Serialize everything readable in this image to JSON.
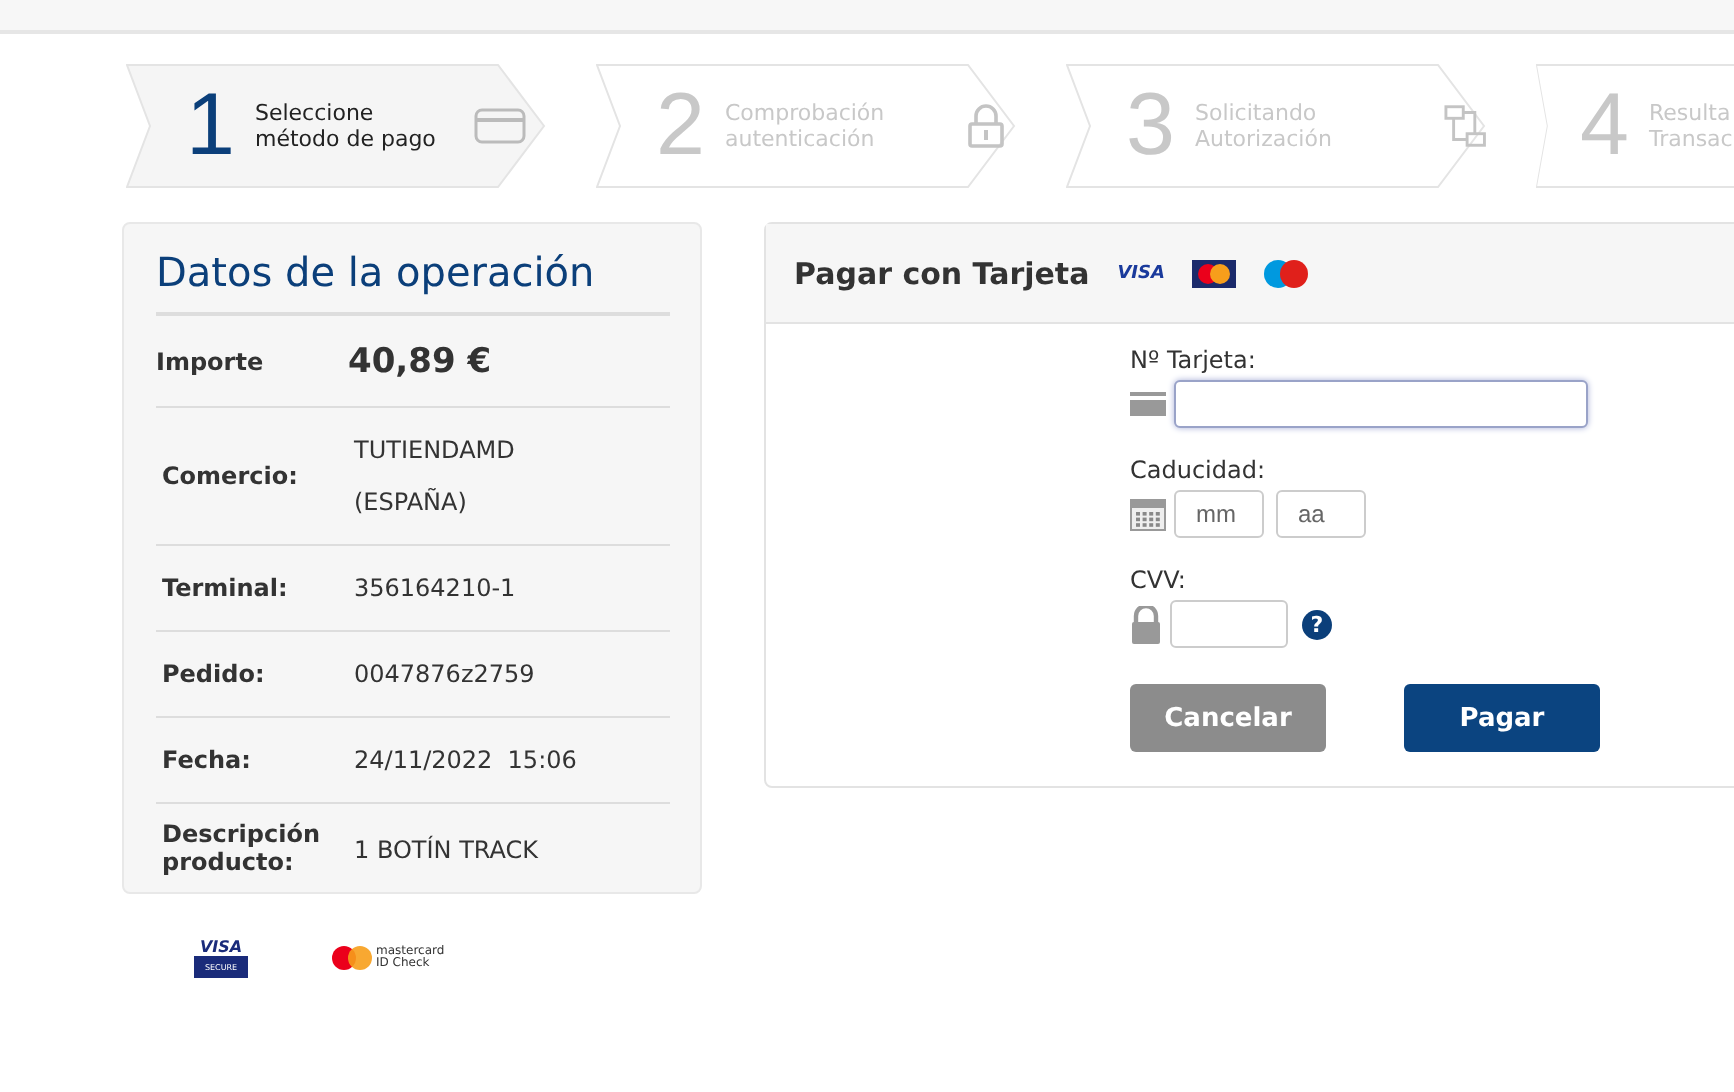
{
  "steps": [
    {
      "number": "1",
      "label": [
        "Seleccione",
        "método de pago"
      ],
      "kind": "card",
      "selected": true
    },
    {
      "number": "2",
      "label": [
        "Comprobación",
        "autenticación"
      ],
      "kind": "lock",
      "selected": false
    },
    {
      "number": "3",
      "label": [
        "Solicitando",
        "Autorización"
      ],
      "kind": "network",
      "selected": false
    },
    {
      "number": "4",
      "label": [
        "Resulta",
        "Transac"
      ],
      "kind": "plain",
      "selected": false
    }
  ],
  "operation": {
    "title": "Datos de la operación",
    "amount_label": "Importe",
    "amount": "40,89 €",
    "rows": [
      {
        "label": "Comercio:",
        "value": [
          "TUTIENDAMD",
          "(ESPAÑA)"
        ]
      },
      {
        "label": "Terminal:",
        "value": [
          "356164210-1"
        ]
      },
      {
        "label": "Pedido:",
        "value": [
          "0047876z2759"
        ]
      },
      {
        "label": "Fecha:",
        "value": [
          "24/11/2022  15:06"
        ]
      },
      {
        "label": "Descripción producto:",
        "value": [
          "1 BOTÍN TRACK"
        ]
      }
    ]
  },
  "secure_logos": {
    "visa_top": "VISA",
    "visa_bottom": "SECURE",
    "mc_top": "mastercard",
    "mc_bottom": "ID Check"
  },
  "payment": {
    "title": "Pagar con Tarjeta",
    "visa_logo": "VISA",
    "card_label": "Nº Tarjeta:",
    "expiry_label": "Caducidad:",
    "month_placeholder": "mm",
    "year_placeholder": "aa",
    "cvv_label": "CVV:",
    "help": "?",
    "cancel": "Cancelar",
    "pay": "Pagar"
  }
}
